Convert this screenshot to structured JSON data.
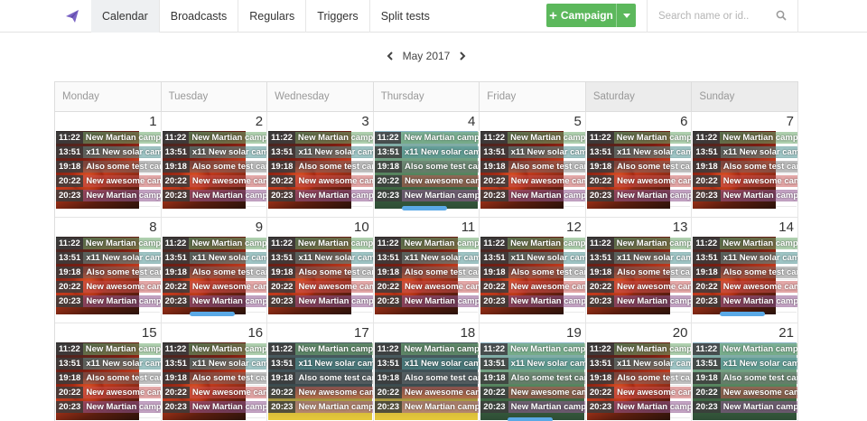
{
  "nav": {
    "tabs": [
      {
        "label": "Calendar",
        "active": true
      },
      {
        "label": "Broadcasts",
        "active": false
      },
      {
        "label": "Regulars",
        "active": false
      },
      {
        "label": "Triggers",
        "active": false
      },
      {
        "label": "Split tests",
        "active": false
      }
    ],
    "campaign_button": "Campaign",
    "search_placeholder": "Search name or id.."
  },
  "calendar": {
    "month_label": "May 2017",
    "weekdays": [
      "Monday",
      "Tuesday",
      "Wednesday",
      "Thursday",
      "Friday",
      "Saturday",
      "Sunday"
    ],
    "events": [
      {
        "time": "11:22",
        "title": "New Martian campaign",
        "color": "green"
      },
      {
        "time": "13:51",
        "title": "x11 New solar campaign",
        "color": "teal"
      },
      {
        "time": "19:18",
        "title": "Also some test campaign",
        "color": "gray"
      },
      {
        "time": "20:22",
        "title": "New awesome campaign",
        "color": "red"
      },
      {
        "time": "20:23",
        "title": "New Martian campaign",
        "color": "purple"
      }
    ],
    "weeks": [
      [
        1,
        2,
        3,
        4,
        5,
        6,
        7
      ],
      [
        8,
        9,
        10,
        11,
        12,
        13,
        14
      ],
      [
        15,
        16,
        17,
        18,
        19,
        20,
        21
      ]
    ]
  },
  "colors": {
    "accent_green": "#5cb85c",
    "active_tab_bg": "#eef0f2"
  }
}
